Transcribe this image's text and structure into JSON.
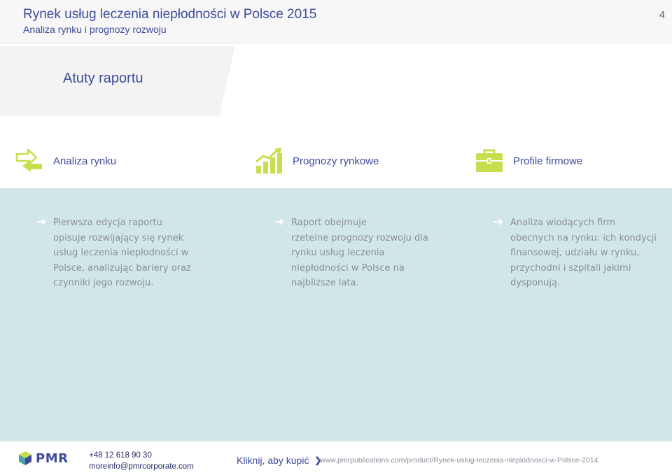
{
  "header": {
    "title": "Rynek usług leczenia niepłodności w Polsce 2015",
    "subtitle": "Analiza rynku i prognozy rozwoju",
    "page_number": "4"
  },
  "banner": {
    "title": "Atuty raportu"
  },
  "features": [
    {
      "label": "Analiza rynku",
      "icon": "arrows-exchange-icon"
    },
    {
      "label": "Prognozy rynkowe",
      "icon": "growth-chart-icon"
    },
    {
      "label": "Profile firmowe",
      "icon": "briefcase-icon"
    }
  ],
  "columns": [
    {
      "text": "Pierwsza edycja raportu\nopisuje rozwijający się rynek\nusług leczenia niepłodności w\nPolsce, analizując bariery oraz\nczynniki jego rozwoju."
    },
    {
      "text": "Raport obejmuje\nrzetelne prognozy rozwoju dla\nrynku usług leczenia\nniepłodności w Polsce na\nnajbliższe lata."
    },
    {
      "text": "Analiza wiodących firm\nobecnych na rynku: ich kondycji\nfinansowej, udziału w rynku,\nprzychodni i szpitali jakimi\ndysponują."
    }
  ],
  "footer": {
    "logo": "PMR",
    "phone": "+48 12 618 90 30",
    "email": "moreinfo@pmrcorporate.com",
    "buy_label": "Kliknij, aby kupić",
    "url": "www.pmrpublications.com/product/Rynek-uslug-leczenia-nieplodnosci-w-Polsce-2014"
  },
  "colors": {
    "accent": "#3e4b9c",
    "icon_green": "#c9de4c",
    "panel": "#d1e6e8"
  }
}
